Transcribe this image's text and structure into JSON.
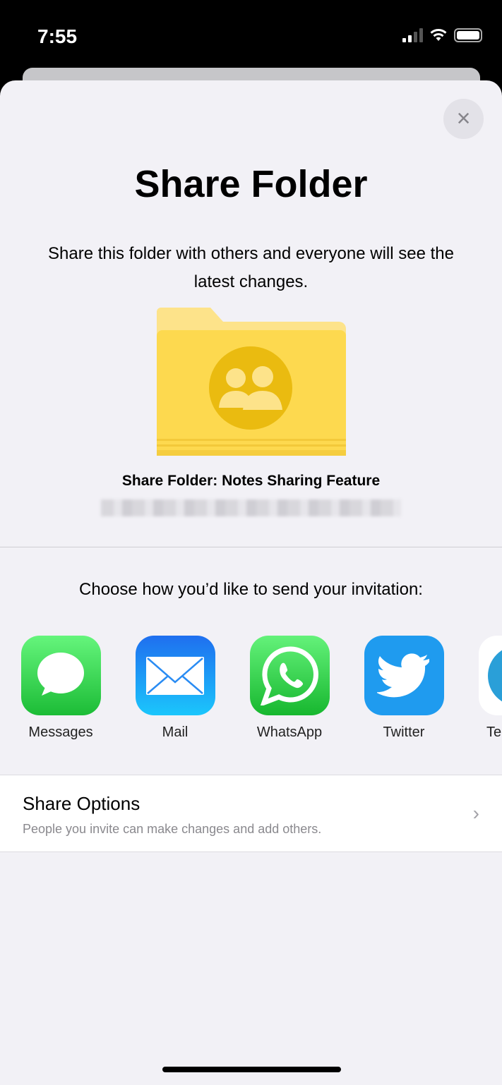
{
  "status_bar": {
    "time": "7:55",
    "icons": [
      "cellular-signal-icon",
      "wifi-icon",
      "battery-icon"
    ]
  },
  "sheet": {
    "close_icon": "×",
    "title": "Share Folder",
    "description": "Share this folder with others and everyone will see the latest changes.",
    "folder_name": "Share Folder: Notes Sharing Feature",
    "choose_label": "Choose how you’d like to send your invitation:",
    "apps": [
      {
        "label": "Messages",
        "icon": "messages-icon"
      },
      {
        "label": "Mail",
        "icon": "mail-icon"
      },
      {
        "label": "WhatsApp",
        "icon": "whatsapp-icon"
      },
      {
        "label": "Twitter",
        "icon": "twitter-icon"
      },
      {
        "label": "Te",
        "icon": "telegram-icon"
      }
    ],
    "share_options": {
      "title": "Share Options",
      "subtitle": "People you invite can make changes and add others.",
      "chevron": "›"
    }
  },
  "colors": {
    "background": "#f2f1f6",
    "folder": "#fdd94f",
    "messages": "#34c759",
    "mail": "#1e8cf5",
    "whatsapp": "#29c43f",
    "twitter": "#1d9bf0"
  }
}
